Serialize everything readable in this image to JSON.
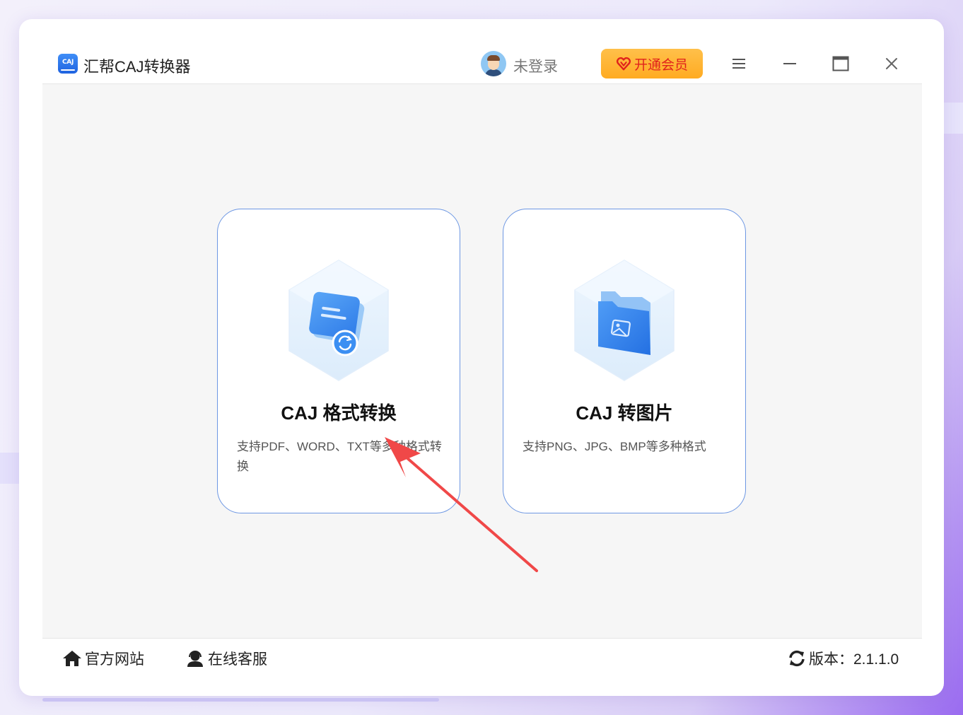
{
  "app": {
    "title": "汇帮CAJ转换器",
    "logo_text": "CAJ"
  },
  "header": {
    "login_status": "未登录",
    "vip_label": "开通会员"
  },
  "cards": [
    {
      "title": "CAJ 格式转换",
      "description": "支持PDF、WORD、TXT等多种格式转换"
    },
    {
      "title": "CAJ 转图片",
      "description": "支持PNG、JPG、BMP等多种格式"
    }
  ],
  "footer": {
    "website_label": "官方网站",
    "support_label": "在线客服",
    "version_label": "版本：2.1.1.0"
  },
  "icons": {
    "logo": "caj-logo-icon",
    "avatar": "user-avatar",
    "vip": "heart-diamond-icon",
    "menu": "menu-icon",
    "minimize": "minimize-icon",
    "maximize": "maximize-icon",
    "close": "close-icon",
    "home": "home-icon",
    "support": "headset-user-icon",
    "refresh": "refresh-icon"
  },
  "colors": {
    "accent": "#2f6fe4",
    "vip_bg": "#ffb331",
    "vip_text": "#e0211c",
    "card_border": "#6d97e3",
    "annotation_arrow": "#f04848"
  }
}
